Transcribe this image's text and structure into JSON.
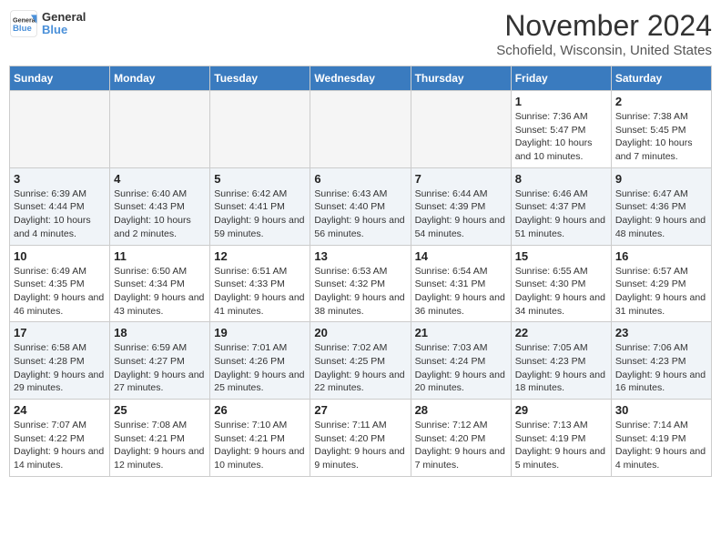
{
  "logo": {
    "text_general": "General",
    "text_blue": "Blue"
  },
  "title": "November 2024",
  "location": "Schofield, Wisconsin, United States",
  "days_of_week": [
    "Sunday",
    "Monday",
    "Tuesday",
    "Wednesday",
    "Thursday",
    "Friday",
    "Saturday"
  ],
  "weeks": [
    [
      {
        "day": "",
        "sunrise": "",
        "sunset": "",
        "daylight": "",
        "empty": true
      },
      {
        "day": "",
        "sunrise": "",
        "sunset": "",
        "daylight": "",
        "empty": true
      },
      {
        "day": "",
        "sunrise": "",
        "sunset": "",
        "daylight": "",
        "empty": true
      },
      {
        "day": "",
        "sunrise": "",
        "sunset": "",
        "daylight": "",
        "empty": true
      },
      {
        "day": "",
        "sunrise": "",
        "sunset": "",
        "daylight": "",
        "empty": true
      },
      {
        "day": "1",
        "sunrise": "Sunrise: 7:36 AM",
        "sunset": "Sunset: 5:47 PM",
        "daylight": "Daylight: 10 hours and 10 minutes.",
        "empty": false
      },
      {
        "day": "2",
        "sunrise": "Sunrise: 7:38 AM",
        "sunset": "Sunset: 5:45 PM",
        "daylight": "Daylight: 10 hours and 7 minutes.",
        "empty": false
      }
    ],
    [
      {
        "day": "3",
        "sunrise": "Sunrise: 6:39 AM",
        "sunset": "Sunset: 4:44 PM",
        "daylight": "Daylight: 10 hours and 4 minutes.",
        "empty": false
      },
      {
        "day": "4",
        "sunrise": "Sunrise: 6:40 AM",
        "sunset": "Sunset: 4:43 PM",
        "daylight": "Daylight: 10 hours and 2 minutes.",
        "empty": false
      },
      {
        "day": "5",
        "sunrise": "Sunrise: 6:42 AM",
        "sunset": "Sunset: 4:41 PM",
        "daylight": "Daylight: 9 hours and 59 minutes.",
        "empty": false
      },
      {
        "day": "6",
        "sunrise": "Sunrise: 6:43 AM",
        "sunset": "Sunset: 4:40 PM",
        "daylight": "Daylight: 9 hours and 56 minutes.",
        "empty": false
      },
      {
        "day": "7",
        "sunrise": "Sunrise: 6:44 AM",
        "sunset": "Sunset: 4:39 PM",
        "daylight": "Daylight: 9 hours and 54 minutes.",
        "empty": false
      },
      {
        "day": "8",
        "sunrise": "Sunrise: 6:46 AM",
        "sunset": "Sunset: 4:37 PM",
        "daylight": "Daylight: 9 hours and 51 minutes.",
        "empty": false
      },
      {
        "day": "9",
        "sunrise": "Sunrise: 6:47 AM",
        "sunset": "Sunset: 4:36 PM",
        "daylight": "Daylight: 9 hours and 48 minutes.",
        "empty": false
      }
    ],
    [
      {
        "day": "10",
        "sunrise": "Sunrise: 6:49 AM",
        "sunset": "Sunset: 4:35 PM",
        "daylight": "Daylight: 9 hours and 46 minutes.",
        "empty": false
      },
      {
        "day": "11",
        "sunrise": "Sunrise: 6:50 AM",
        "sunset": "Sunset: 4:34 PM",
        "daylight": "Daylight: 9 hours and 43 minutes.",
        "empty": false
      },
      {
        "day": "12",
        "sunrise": "Sunrise: 6:51 AM",
        "sunset": "Sunset: 4:33 PM",
        "daylight": "Daylight: 9 hours and 41 minutes.",
        "empty": false
      },
      {
        "day": "13",
        "sunrise": "Sunrise: 6:53 AM",
        "sunset": "Sunset: 4:32 PM",
        "daylight": "Daylight: 9 hours and 38 minutes.",
        "empty": false
      },
      {
        "day": "14",
        "sunrise": "Sunrise: 6:54 AM",
        "sunset": "Sunset: 4:31 PM",
        "daylight": "Daylight: 9 hours and 36 minutes.",
        "empty": false
      },
      {
        "day": "15",
        "sunrise": "Sunrise: 6:55 AM",
        "sunset": "Sunset: 4:30 PM",
        "daylight": "Daylight: 9 hours and 34 minutes.",
        "empty": false
      },
      {
        "day": "16",
        "sunrise": "Sunrise: 6:57 AM",
        "sunset": "Sunset: 4:29 PM",
        "daylight": "Daylight: 9 hours and 31 minutes.",
        "empty": false
      }
    ],
    [
      {
        "day": "17",
        "sunrise": "Sunrise: 6:58 AM",
        "sunset": "Sunset: 4:28 PM",
        "daylight": "Daylight: 9 hours and 29 minutes.",
        "empty": false
      },
      {
        "day": "18",
        "sunrise": "Sunrise: 6:59 AM",
        "sunset": "Sunset: 4:27 PM",
        "daylight": "Daylight: 9 hours and 27 minutes.",
        "empty": false
      },
      {
        "day": "19",
        "sunrise": "Sunrise: 7:01 AM",
        "sunset": "Sunset: 4:26 PM",
        "daylight": "Daylight: 9 hours and 25 minutes.",
        "empty": false
      },
      {
        "day": "20",
        "sunrise": "Sunrise: 7:02 AM",
        "sunset": "Sunset: 4:25 PM",
        "daylight": "Daylight: 9 hours and 22 minutes.",
        "empty": false
      },
      {
        "day": "21",
        "sunrise": "Sunrise: 7:03 AM",
        "sunset": "Sunset: 4:24 PM",
        "daylight": "Daylight: 9 hours and 20 minutes.",
        "empty": false
      },
      {
        "day": "22",
        "sunrise": "Sunrise: 7:05 AM",
        "sunset": "Sunset: 4:23 PM",
        "daylight": "Daylight: 9 hours and 18 minutes.",
        "empty": false
      },
      {
        "day": "23",
        "sunrise": "Sunrise: 7:06 AM",
        "sunset": "Sunset: 4:23 PM",
        "daylight": "Daylight: 9 hours and 16 minutes.",
        "empty": false
      }
    ],
    [
      {
        "day": "24",
        "sunrise": "Sunrise: 7:07 AM",
        "sunset": "Sunset: 4:22 PM",
        "daylight": "Daylight: 9 hours and 14 minutes.",
        "empty": false
      },
      {
        "day": "25",
        "sunrise": "Sunrise: 7:08 AM",
        "sunset": "Sunset: 4:21 PM",
        "daylight": "Daylight: 9 hours and 12 minutes.",
        "empty": false
      },
      {
        "day": "26",
        "sunrise": "Sunrise: 7:10 AM",
        "sunset": "Sunset: 4:21 PM",
        "daylight": "Daylight: 9 hours and 10 minutes.",
        "empty": false
      },
      {
        "day": "27",
        "sunrise": "Sunrise: 7:11 AM",
        "sunset": "Sunset: 4:20 PM",
        "daylight": "Daylight: 9 hours and 9 minutes.",
        "empty": false
      },
      {
        "day": "28",
        "sunrise": "Sunrise: 7:12 AM",
        "sunset": "Sunset: 4:20 PM",
        "daylight": "Daylight: 9 hours and 7 minutes.",
        "empty": false
      },
      {
        "day": "29",
        "sunrise": "Sunrise: 7:13 AM",
        "sunset": "Sunset: 4:19 PM",
        "daylight": "Daylight: 9 hours and 5 minutes.",
        "empty": false
      },
      {
        "day": "30",
        "sunrise": "Sunrise: 7:14 AM",
        "sunset": "Sunset: 4:19 PM",
        "daylight": "Daylight: 9 hours and 4 minutes.",
        "empty": false
      }
    ]
  ]
}
